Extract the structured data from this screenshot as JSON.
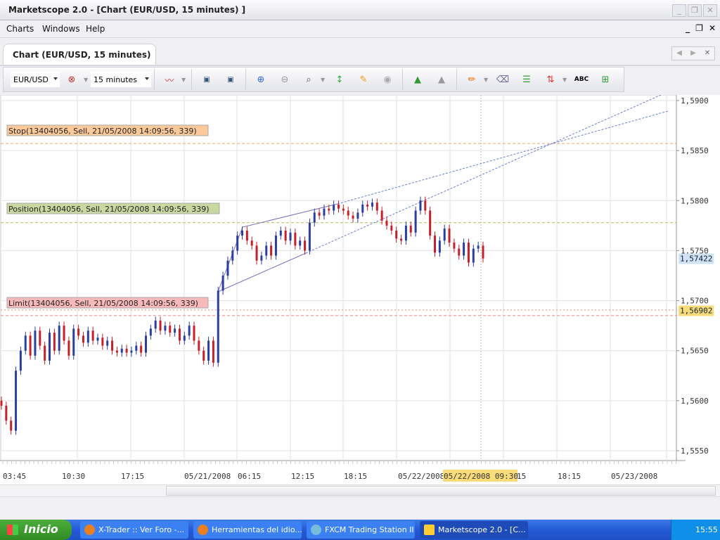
{
  "window": {
    "title": "Marketscope 2.0 - [Chart (EUR/USD, 15 minutes) ]",
    "controls": [
      "_",
      "❐",
      "✕"
    ]
  },
  "menu": [
    "Charts",
    "Windows",
    "Help"
  ],
  "mdi_controls": [
    "_",
    "❐",
    "✕"
  ],
  "tab": {
    "label": "Chart (EUR/USD, 15 minutes)",
    "nav": [
      "◀",
      "▶",
      "✕"
    ]
  },
  "toolbar": {
    "instrument": "EUR/USD",
    "timeframe": "15 minutes"
  },
  "chart_data": {
    "type": "candlestick",
    "ylim": [
      1.5535,
      1.591
    ],
    "y_ticks": [
      "1,5900",
      "1,5850",
      "1,5800",
      "1,5750",
      "1,5700",
      "1,5650",
      "1,5600",
      "1,5550"
    ],
    "y_tick_values": [
      1.59,
      1.585,
      1.58,
      1.575,
      1.57,
      1.565,
      1.56,
      1.555
    ],
    "x_ticks": [
      "03:45",
      "10:30",
      "17:15",
      "05/21/2008",
      "06:15",
      "12:15",
      "18:15",
      "05/22/2008",
      "15",
      "18:15",
      "05/23/2008"
    ],
    "crosshair_time": "05/22/2008 09:30",
    "current_price": "1,57422",
    "current_price_value": 1.57422,
    "limit_price": "1,56902",
    "limit_price_value": 1.56902,
    "closes": [
      1.5595,
      1.558,
      1.557,
      1.563,
      1.565,
      1.5665,
      1.5645,
      1.567,
      1.5655,
      1.564,
      1.5668,
      1.565,
      1.5675,
      1.566,
      1.5645,
      1.5672,
      1.5665,
      1.5658,
      1.567,
      1.566,
      1.5663,
      1.5655,
      1.566,
      1.565,
      1.5648,
      1.5652,
      1.5648,
      1.565,
      1.5655,
      1.5648,
      1.5665,
      1.5672,
      1.568,
      1.567,
      1.5675,
      1.5668,
      1.5672,
      1.566,
      1.5665,
      1.5675,
      1.566,
      1.565,
      1.564,
      1.566,
      1.5638,
      1.571,
      1.5725,
      1.574,
      1.575,
      1.5765,
      1.577,
      1.576,
      1.5755,
      1.574,
      1.5745,
      1.5755,
      1.5745,
      1.5765,
      1.577,
      1.576,
      1.5768,
      1.5755,
      1.576,
      1.575,
      1.5778,
      1.5788,
      1.5785,
      1.5792,
      1.579,
      1.5796,
      1.5792,
      1.579,
      1.5785,
      1.5782,
      1.5788,
      1.5796,
      1.5794,
      1.5798,
      1.579,
      1.578,
      1.5775,
      1.577,
      1.5762,
      1.576,
      1.5775,
      1.5768,
      1.579,
      1.58,
      1.579,
      1.5765,
      1.5748,
      1.576,
      1.5772,
      1.5758,
      1.5752,
      1.5745,
      1.5758,
      1.5738,
      1.5752,
      1.5755,
      1.57422
    ],
    "orders": [
      {
        "label": "Stop(13404056, Sell, 21/05/2008 14:09:56, 339)",
        "price": 1.5857,
        "color": "#f5a060",
        "bg": "#fbc99a"
      },
      {
        "label": "Position(13404056, Sell, 21/05/2008 14:09:56, 339)",
        "price": 1.5778,
        "color": "#b5c060",
        "bg": "#c9d7a0"
      },
      {
        "label": "Limit(13404056, Sell, 21/05/2008 14:09:56, 339)",
        "price": 1.5685,
        "color": "#f08080",
        "bg": "#f7b9b9"
      }
    ]
  },
  "taskbar": {
    "start": "Inicio",
    "tasks": [
      "X-Trader :: Ver Foro -...",
      "Herramientas del idio...",
      "FXCM Trading Station II",
      "Marketscope 2.0 - [C..."
    ],
    "clock": "15:55"
  }
}
